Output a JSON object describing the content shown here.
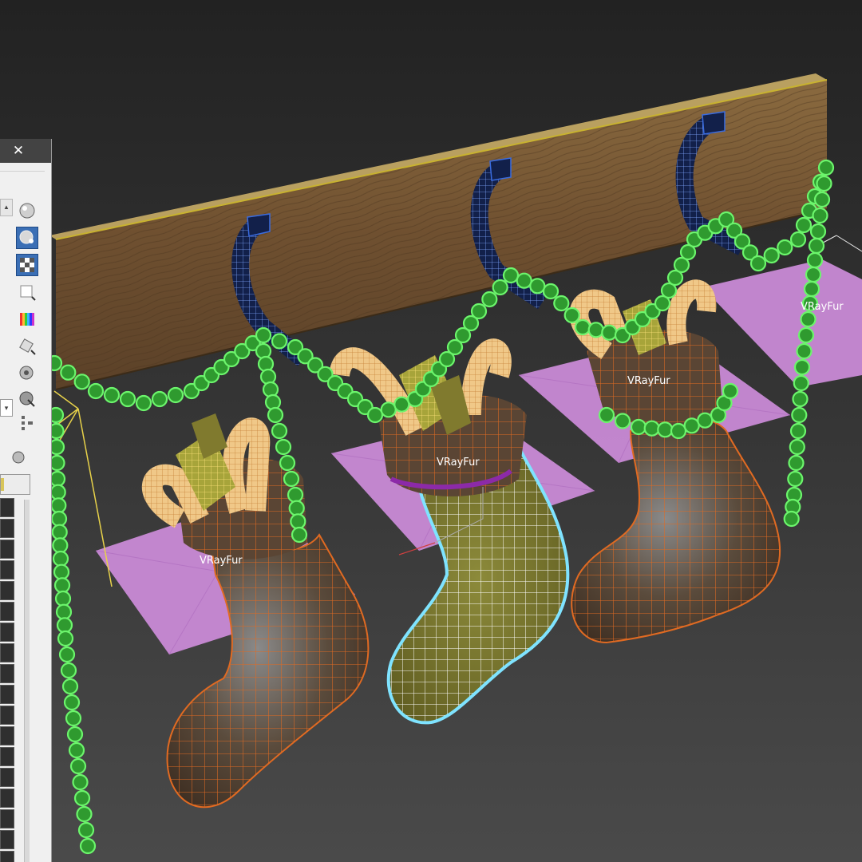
{
  "viewport": {
    "fur_labels": [
      "VRayFur",
      "VRayFur",
      "VRayFur",
      "VRayFur"
    ],
    "colors": {
      "background_top": "#232323",
      "background_bottom": "#4a4a4a",
      "shelf_wood": "#7a5a33",
      "hook_wire": "#3a6ce0",
      "garland": "#6cf56c",
      "fur_plane": "#c98ad6",
      "stocking_wire": "#d66a2a",
      "selected_stocking": "#7e7a2e",
      "selection_outline": "#7fe3ff",
      "candy_cane": "#f0c888",
      "gift": "#b8a53a"
    }
  },
  "panel": {
    "close_label": "✕",
    "tools": [
      {
        "name": "sample-sphere-icon",
        "selected": false
      },
      {
        "name": "backlight-icon",
        "selected": true
      },
      {
        "name": "checker-background-icon",
        "selected": true
      },
      {
        "name": "sample-uv-icon",
        "selected": false
      },
      {
        "name": "video-color-check-icon",
        "selected": false
      },
      {
        "name": "make-preview-icon",
        "selected": false
      },
      {
        "name": "material-options-icon",
        "selected": false
      },
      {
        "name": "select-by-material-icon",
        "selected": false
      },
      {
        "name": "material-map-navigator-icon",
        "selected": false
      }
    ]
  }
}
